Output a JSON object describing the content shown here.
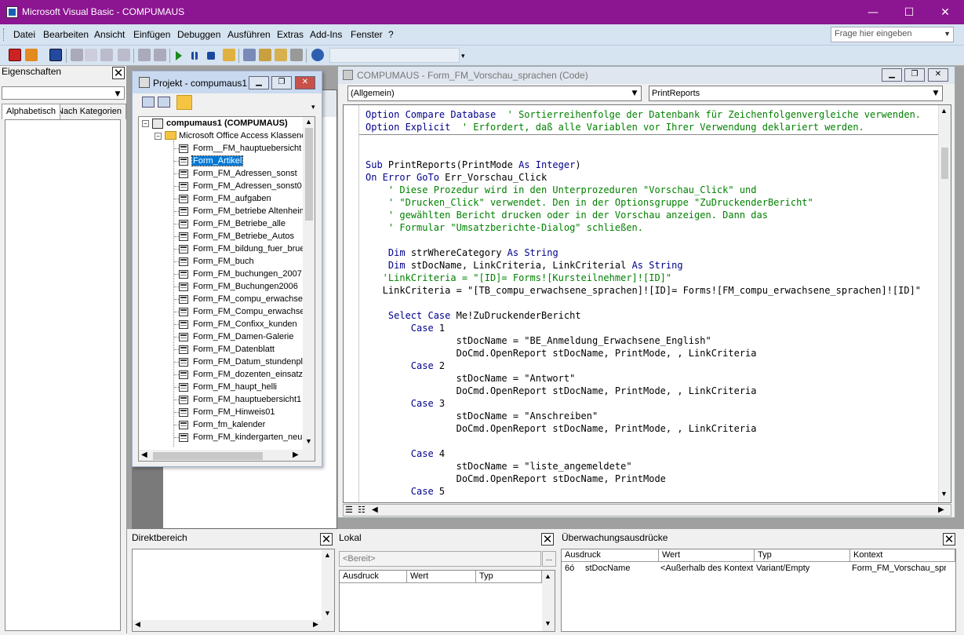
{
  "window": {
    "title": "Microsoft Visual Basic - COMPUMAUS",
    "min_glyph": "—",
    "max_glyph": "☐",
    "close_glyph": "✕"
  },
  "menu": {
    "items": [
      "Datei",
      "Bearbeiten",
      "Ansicht",
      "Einfügen",
      "Debuggen",
      "Ausführen",
      "Extras",
      "Add-Ins",
      "Fenster",
      "?"
    ],
    "help_placeholder": "Frage hier eingeben"
  },
  "properties": {
    "title": "Eigenschaften",
    "tabs": [
      "Alphabetisch",
      "Nach Kategorien"
    ]
  },
  "project": {
    "title": "Projekt - compumaus1",
    "root": "compumaus1 (COMPUMAUS)",
    "folder": "Microsoft Office Access Klassenobjekte",
    "items": [
      "Form__FM_hauptuebersicht",
      "Form_Artikel",
      "Form_FM_Adressen_sonst",
      "Form_FM_Adressen_sonst0",
      "Form_FM_aufgaben",
      "Form_FM_betriebe Altenheim",
      "Form_FM_Betriebe_alle",
      "Form_FM_Betriebe_Autos",
      "Form_FM_bildung_fuer_bruehl",
      "Form_FM_buch",
      "Form_FM_buchungen_2007",
      "Form_FM_Buchungen2006",
      "Form_FM_compu_erwachsene",
      "Form_FM_Compu_erwachsene_S",
      "Form_FM_Confixx_kunden",
      "Form_FM_Damen-Galerie",
      "Form_FM_Datenblatt",
      "Form_FM_Datum_stundenplan",
      "Form_FM_dozenten_einsatz",
      "Form_FM_haupt_helli",
      "Form_FM_hauptuebersicht1",
      "Form_FM_Hinweis01",
      "Form_fm_kalender",
      "Form_FM_kindergarten_neu"
    ],
    "selected_index": 1
  },
  "code_window": {
    "title": "COMPUMAUS - Form_FM_Vorschau_sprachen (Code)",
    "object_combo": "(Allgemein)",
    "proc_combo": "PrintReports"
  },
  "code_lines": [
    {
      "parts": [
        [
          "kw",
          "Option Compare Database"
        ],
        [
          "cm",
          "  ' Sortierreihenfolge der Datenbank für Zeichenfolgenvergleiche verwenden."
        ]
      ]
    },
    {
      "parts": [
        [
          "kw",
          "Option Explicit"
        ],
        [
          "cm",
          "  ' Erfordert, daß alle Variablen vor Ihrer Verwendung deklariert werden."
        ]
      ]
    },
    {
      "parts": []
    },
    {
      "parts": []
    },
    {
      "parts": [
        [
          "kw",
          "Sub"
        ],
        [
          "tx",
          " PrintReports(PrintMode "
        ],
        [
          "kw",
          "As Integer"
        ],
        [
          "tx",
          ")"
        ]
      ]
    },
    {
      "parts": [
        [
          "kw",
          "On Error GoTo"
        ],
        [
          "tx",
          " Err_Vorschau_Click"
        ]
      ]
    },
    {
      "parts": [
        [
          "cm",
          "    ' Diese Prozedur wird in den Unterprozeduren \"Vorschau_Click\" und"
        ]
      ]
    },
    {
      "parts": [
        [
          "cm",
          "    ' \"Drucken_Click\" verwendet. Den in der Optionsgruppe \"ZuDruckenderBericht\""
        ]
      ]
    },
    {
      "parts": [
        [
          "cm",
          "    ' gewählten Bericht drucken oder in der Vorschau anzeigen. Dann das"
        ]
      ]
    },
    {
      "parts": [
        [
          "cm",
          "    ' Formular \"Umsatzberichte-Dialog\" schließen."
        ]
      ]
    },
    {
      "parts": []
    },
    {
      "parts": [
        [
          "tx",
          "    "
        ],
        [
          "kw",
          "Dim"
        ],
        [
          "tx",
          " strWhereCategory "
        ],
        [
          "kw",
          "As String"
        ]
      ]
    },
    {
      "parts": [
        [
          "tx",
          "    "
        ],
        [
          "kw",
          "Dim"
        ],
        [
          "tx",
          " stDocName, LinkCriteria, LinkCriterial "
        ],
        [
          "kw",
          "As String"
        ]
      ]
    },
    {
      "parts": [
        [
          "cm",
          "   'LinkCriteria = \"[ID]= Forms![Kursteilnehmer]![ID]\""
        ]
      ]
    },
    {
      "parts": [
        [
          "tx",
          "   LinkCriteria = \"[TB_compu_erwachsene_sprachen]![ID]= Forms![FM_compu_erwachsene_sprachen]![ID]\""
        ]
      ]
    },
    {
      "parts": []
    },
    {
      "parts": [
        [
          "tx",
          "    "
        ],
        [
          "kw",
          "Select Case"
        ],
        [
          "tx",
          " Me!ZuDruckenderBericht"
        ]
      ]
    },
    {
      "parts": [
        [
          "tx",
          "        "
        ],
        [
          "kw",
          "Case"
        ],
        [
          "tx",
          " 1"
        ]
      ]
    },
    {
      "parts": [
        [
          "tx",
          "                stDocName = \"BE_Anmeldung_Erwachsene_English\""
        ]
      ]
    },
    {
      "parts": [
        [
          "tx",
          "                DoCmd.OpenReport stDocName, PrintMode, , LinkCriteria"
        ]
      ]
    },
    {
      "parts": [
        [
          "tx",
          "        "
        ],
        [
          "kw",
          "Case"
        ],
        [
          "tx",
          " 2"
        ]
      ]
    },
    {
      "parts": [
        [
          "tx",
          "                stDocName = \"Antwort\""
        ]
      ]
    },
    {
      "parts": [
        [
          "tx",
          "                DoCmd.OpenReport stDocName, PrintMode, , LinkCriteria"
        ]
      ]
    },
    {
      "parts": [
        [
          "tx",
          "        "
        ],
        [
          "kw",
          "Case"
        ],
        [
          "tx",
          " 3"
        ]
      ]
    },
    {
      "parts": [
        [
          "tx",
          "                stDocName = \"Anschreiben\""
        ]
      ]
    },
    {
      "parts": [
        [
          "tx",
          "                DoCmd.OpenReport stDocName, PrintMode, , LinkCriteria"
        ]
      ]
    },
    {
      "parts": []
    },
    {
      "parts": [
        [
          "tx",
          "        "
        ],
        [
          "kw",
          "Case"
        ],
        [
          "tx",
          " 4"
        ]
      ]
    },
    {
      "parts": [
        [
          "tx",
          "                stDocName = \"liste_angemeldete\""
        ]
      ]
    },
    {
      "parts": [
        [
          "tx",
          "                DoCmd.OpenReport stDocName, PrintMode"
        ]
      ]
    },
    {
      "parts": [
        [
          "tx",
          "        "
        ],
        [
          "kw",
          "Case"
        ],
        [
          "tx",
          " 5"
        ]
      ]
    }
  ],
  "immediate": {
    "title": "Direktbereich"
  },
  "locals": {
    "title": "Lokal",
    "status": "<Bereit>",
    "button": "...",
    "columns": [
      "Ausdruck",
      "Wert",
      "Typ"
    ]
  },
  "watches": {
    "title": "Überwachungsausdrücke",
    "columns": [
      "Ausdruck",
      "Wert",
      "Typ",
      "Kontext"
    ],
    "rows": [
      {
        "icon": "6ó",
        "expr": "stDocName",
        "value": "<Außerhalb des Kontexts>",
        "type": "Variant/Empty",
        "context": "Form_FM_Vorschau_sprach"
      }
    ]
  },
  "colors": {
    "titlebar": "#8c1591",
    "keyword": "#00008b",
    "comment": "#008000",
    "selection": "#0078d7"
  }
}
